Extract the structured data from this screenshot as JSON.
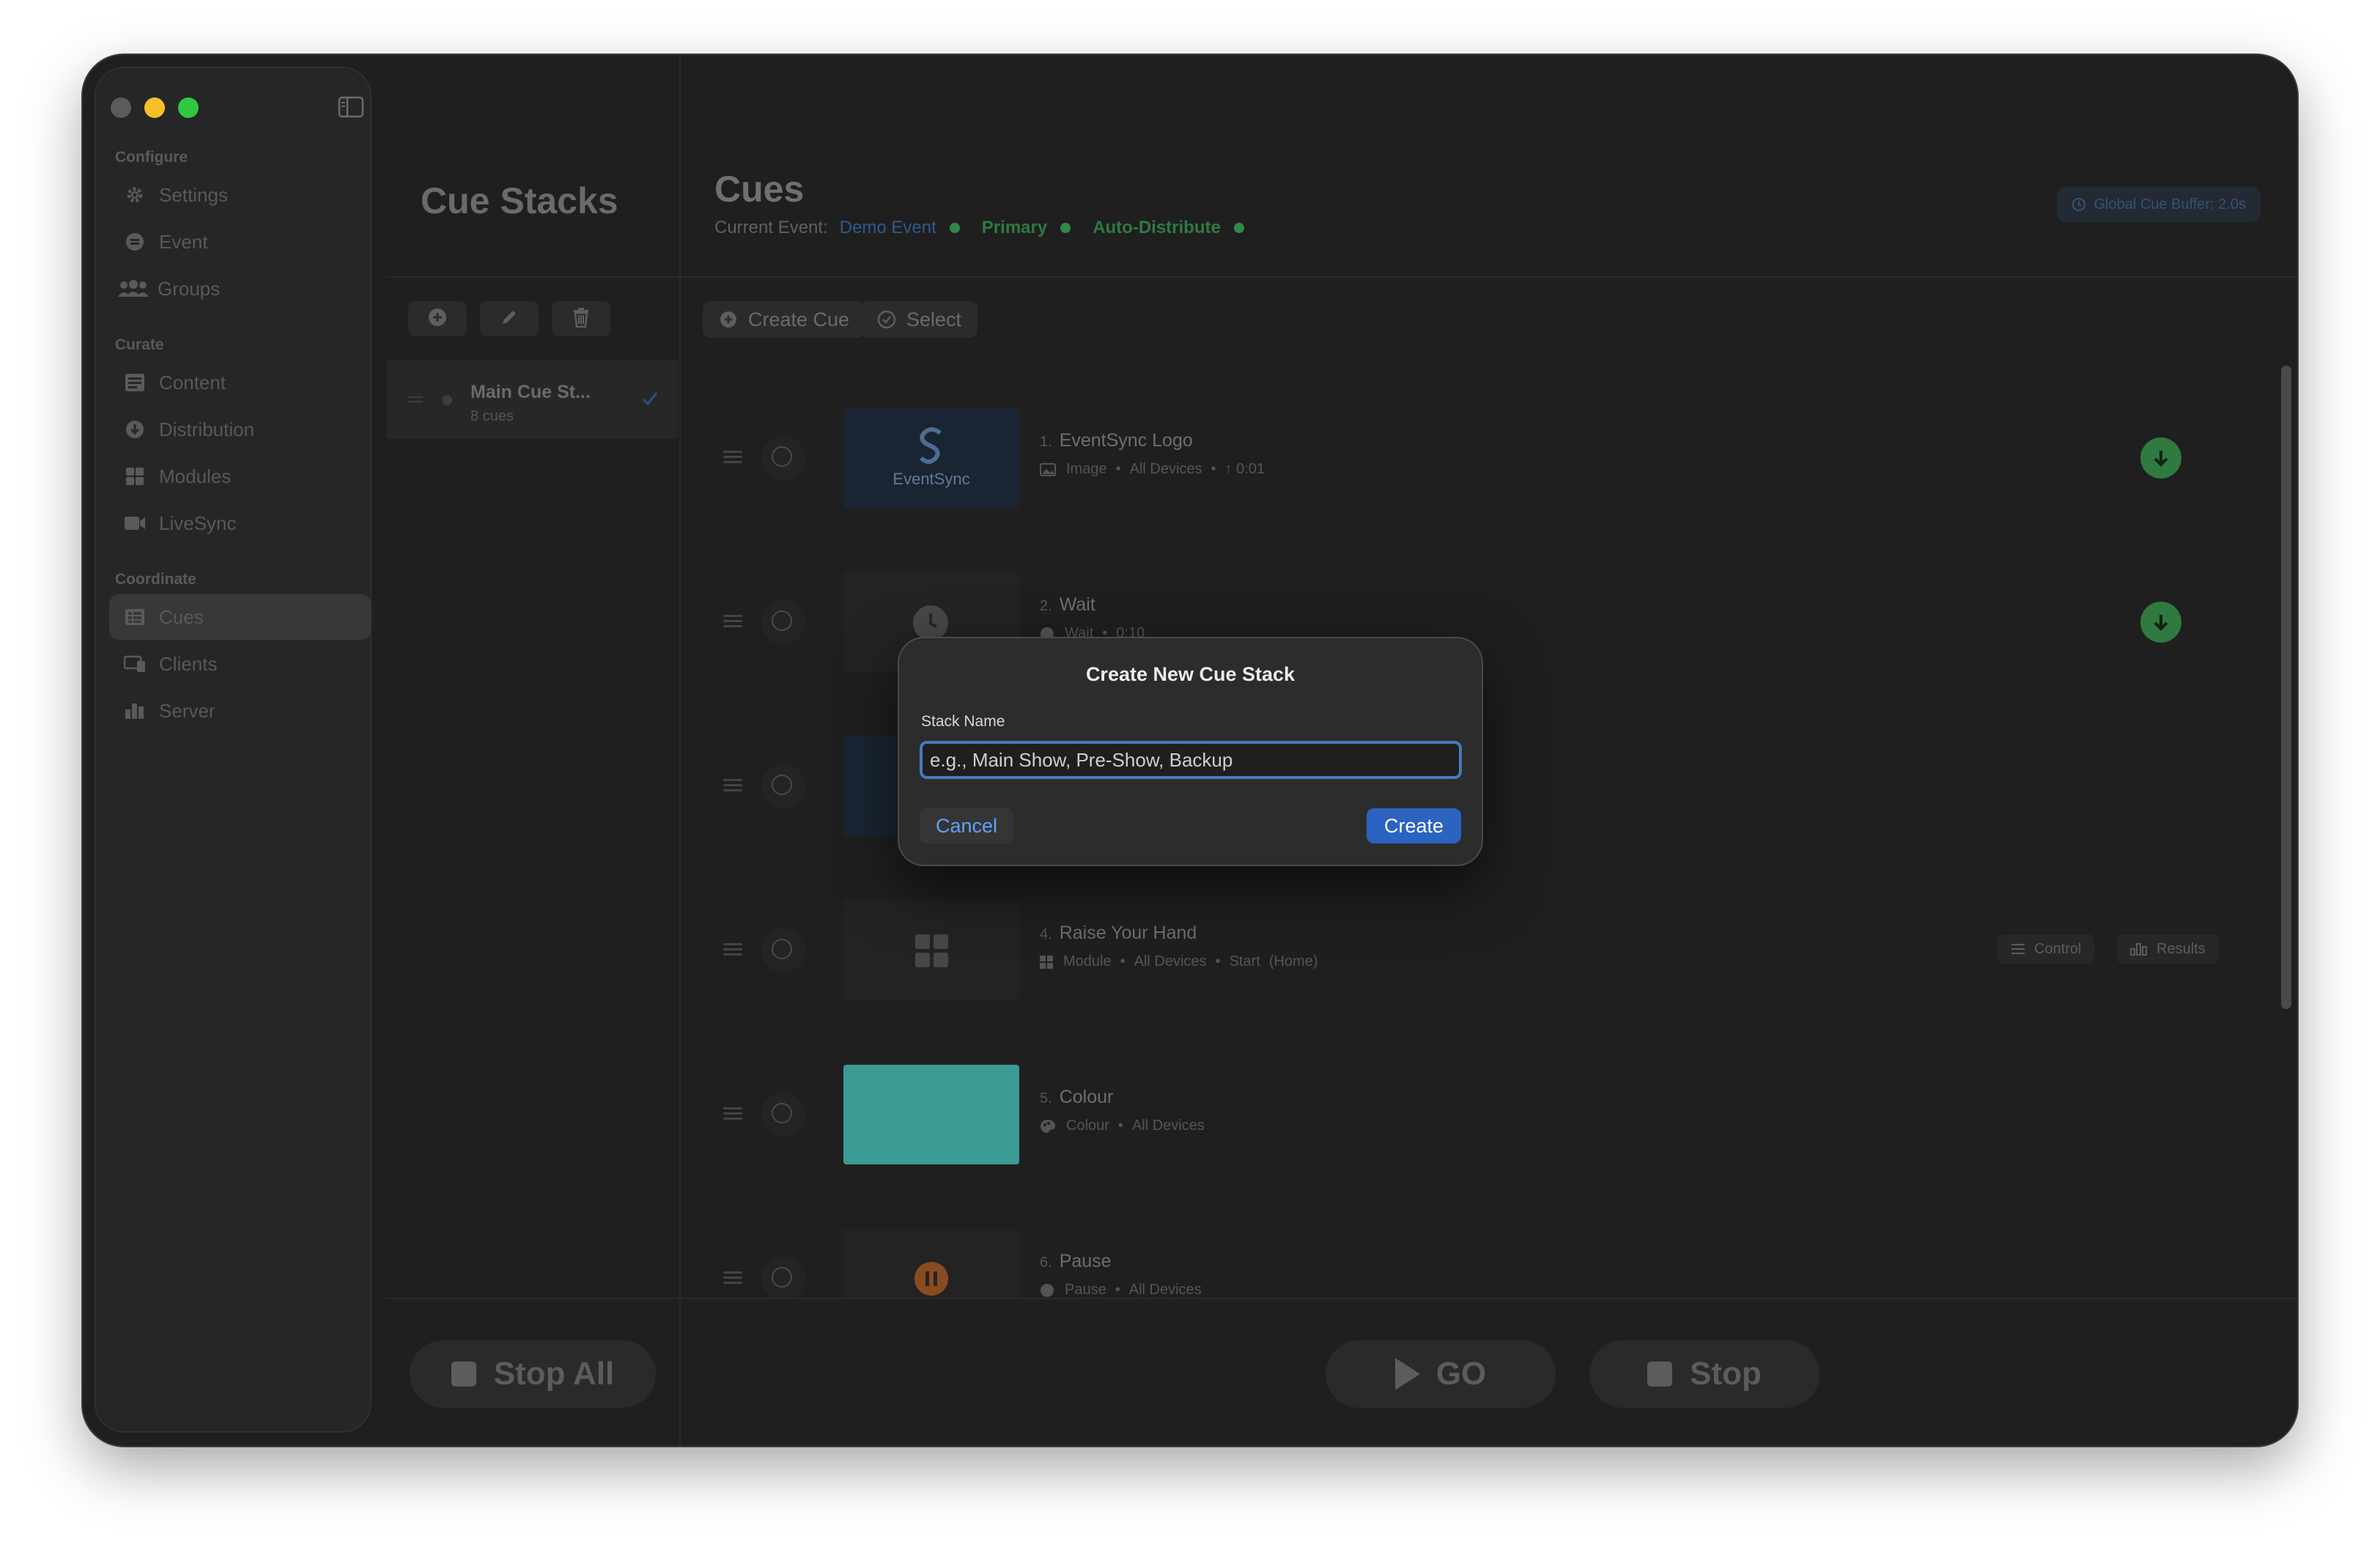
{
  "sidebar": {
    "sections": [
      {
        "title": "Configure",
        "items": [
          {
            "label": "Settings",
            "icon": "gear-icon"
          },
          {
            "label": "Event",
            "icon": "event-icon"
          },
          {
            "label": "Groups",
            "icon": "groups-icon"
          }
        ]
      },
      {
        "title": "Curate",
        "items": [
          {
            "label": "Content",
            "icon": "content-icon"
          },
          {
            "label": "Distribution",
            "icon": "distribution-icon"
          },
          {
            "label": "Modules",
            "icon": "modules-icon"
          },
          {
            "label": "LiveSync",
            "icon": "video-icon"
          }
        ]
      },
      {
        "title": "Coordinate",
        "items": [
          {
            "label": "Cues",
            "icon": "cues-icon",
            "selected": true
          },
          {
            "label": "Clients",
            "icon": "clients-icon"
          },
          {
            "label": "Server",
            "icon": "server-icon"
          }
        ]
      }
    ]
  },
  "stacks": {
    "title": "Cue Stacks",
    "items": [
      {
        "name": "Main Cue St...",
        "count": "8 cues",
        "checked": true
      }
    ],
    "stop_all_label": "Stop All"
  },
  "cues": {
    "title": "Cues",
    "current_event_label": "Current Event:",
    "event_name": "Demo Event",
    "status_primary": "Primary",
    "status_auto": "Auto-Distribute",
    "buffer_badge": "Global Cue Buffer: 2.0s",
    "create_cue_label": "Create Cue",
    "select_label": "Select",
    "list": [
      {
        "number": "1.",
        "name": "EventSync Logo",
        "type": "Image",
        "target": "All Devices",
        "extra": "↑ 0:01",
        "thumb_text": "EventSync"
      },
      {
        "number": "2.",
        "name": "Wait",
        "type": "Wait",
        "target": "",
        "extra": "0:10"
      },
      {
        "number": "4.",
        "name": "Raise Your Hand",
        "type": "Module",
        "target": "All Devices",
        "extra": "Start",
        "extra2": "(Home)",
        "control_label": "Control",
        "results_label": "Results"
      },
      {
        "number": "5.",
        "name": "Colour",
        "type": "Colour",
        "target": "All Devices",
        "color": "#3a9a94"
      },
      {
        "number": "6.",
        "name": "Pause",
        "type": "Pause",
        "target": "All Devices"
      }
    ],
    "go_label": "GO",
    "stop_label": "Stop"
  },
  "dialog": {
    "title": "Create New Cue Stack",
    "field_label": "Stack Name",
    "placeholder": "e.g., Main Show, Pre-Show, Backup",
    "cancel_label": "Cancel",
    "create_label": "Create"
  },
  "colors": {
    "accent": "#2b63c0",
    "status_green": "#2e7a41",
    "link": "#5fa2ff"
  }
}
